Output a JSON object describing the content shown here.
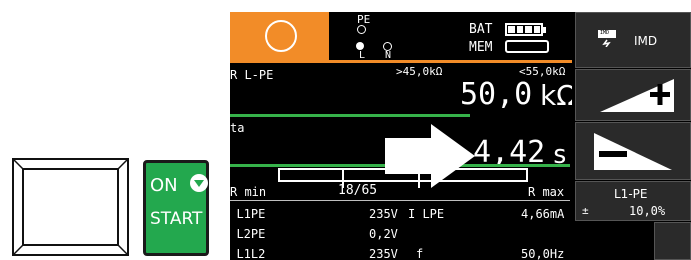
{
  "keys": {
    "on_label": "ON",
    "start_label": "START"
  },
  "screen": {
    "pe_label": "PE",
    "l_label": "L",
    "n_label": "N",
    "bat_label": "BAT",
    "mem_label": "MEM",
    "function_label": "R L-PE",
    "limit_left": ">45,0kΩ",
    "limit_right": "<55,0kΩ",
    "main_value": "50,0",
    "main_unit": "kΩ",
    "ta_label": "ta",
    "ta_value": "4,42",
    "ta_unit": "s",
    "rmin_label": "R min",
    "counter": "18/65",
    "rmax_label": "R max",
    "rows": [
      {
        "left_name": "U L1PE",
        "left_value": "235V",
        "right_name": "I LPE",
        "right_value": "4,66mA"
      },
      {
        "left_name": "U L2PE",
        "left_value": "0,2V",
        "right_name": "",
        "right_value": ""
      },
      {
        "left_name": "U L1L2",
        "left_value": "235V",
        "right_name": "f",
        "right_value": "50,0Hz"
      }
    ]
  },
  "softkeys": {
    "imd_badge": "IMD",
    "imd_label": "IMD",
    "limit_name": "L1-PE",
    "limit_sign": "±",
    "limit_value": "10,0%"
  },
  "colors": {
    "accent_orange": "#f28c28",
    "separator_green": "#36b24a",
    "start_key_green": "#23a84e"
  }
}
